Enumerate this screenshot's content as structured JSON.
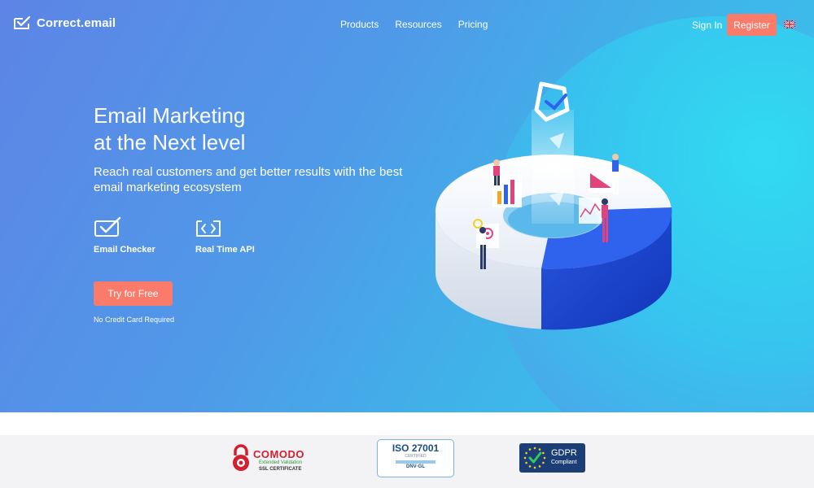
{
  "brand": {
    "name": "Correct.email",
    "icon": "envelope-check-icon"
  },
  "nav": {
    "links": [
      "Products",
      "Resources",
      "Pricing"
    ],
    "sign_in": "Sign In",
    "register": "Register",
    "language_icon": "uk-flag-icon"
  },
  "hero": {
    "headline_line1": "Email Marketing",
    "headline_line2": "at the Next level",
    "subheadline": "Reach real customers and get better results with the best email marketing ecosystem",
    "features": [
      {
        "label": "Email Checker",
        "icon": "envelope-check-icon"
      },
      {
        "label": "Real Time API",
        "icon": "code-envelope-icon"
      }
    ],
    "cta": "Try for Free",
    "cta_note": "No Credit Card Required"
  },
  "trust_badges": {
    "comodo": {
      "title": "COMODO",
      "subtitle": "Extended Validation",
      "ssl": "SSL CERTIFICATE"
    },
    "iso": {
      "title": "ISO 27001",
      "certified": "CERTIFIED",
      "issuer": "DNV·GL"
    },
    "gdpr": {
      "title": "GDPR",
      "subtitle": "Compliant"
    }
  },
  "colors": {
    "accent": "#fb7b6a",
    "hero_gradient_start": "#5d84e6",
    "hero_gradient_end": "#3cc6ec",
    "trust_background": "#f3f3f5"
  }
}
